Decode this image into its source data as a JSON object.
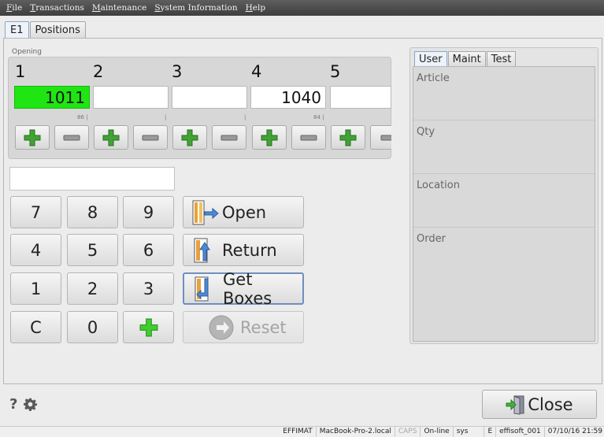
{
  "menu": [
    "File",
    "Transactions",
    "Maintenance",
    "System Information",
    "Help"
  ],
  "tabs": [
    "E1",
    "Positions"
  ],
  "opening": {
    "label": "Opening",
    "columns": [
      "1",
      "2",
      "3",
      "4",
      "5"
    ],
    "values": [
      "1011",
      "",
      "",
      "1040",
      ""
    ],
    "ticks": [
      "86 |",
      "|",
      "|",
      "84 |"
    ]
  },
  "keypad": [
    "7",
    "8",
    "9",
    "4",
    "5",
    "6",
    "1",
    "2",
    "3",
    "C",
    "0"
  ],
  "actions": {
    "open": "Open",
    "return": "Return",
    "get_boxes": "Get Boxes",
    "reset": "Reset"
  },
  "right_tabs": [
    "User",
    "Maint",
    "Test"
  ],
  "fields": [
    "Article",
    "Qty",
    "Location",
    "Order"
  ],
  "help": "?",
  "close_label": "Close",
  "status": {
    "app": "EFFIMAT",
    "host": "MacBook-Pro-2.local",
    "caps": "CAPS",
    "online": "On-line",
    "user": "sys",
    "lang": "E",
    "instance": "effisoft_001",
    "datetime": "07/10/16 21:59"
  },
  "colors": {
    "green_cell": "#1fe612",
    "plus": "#3c9a2e",
    "menubar": "#4a4a4a"
  },
  "icons": [
    "plus-icon",
    "minus-icon",
    "open-shelf-icon",
    "return-shelf-icon",
    "get-boxes-icon",
    "reset-arrow-icon",
    "gear-icon",
    "door-exit-icon"
  ]
}
